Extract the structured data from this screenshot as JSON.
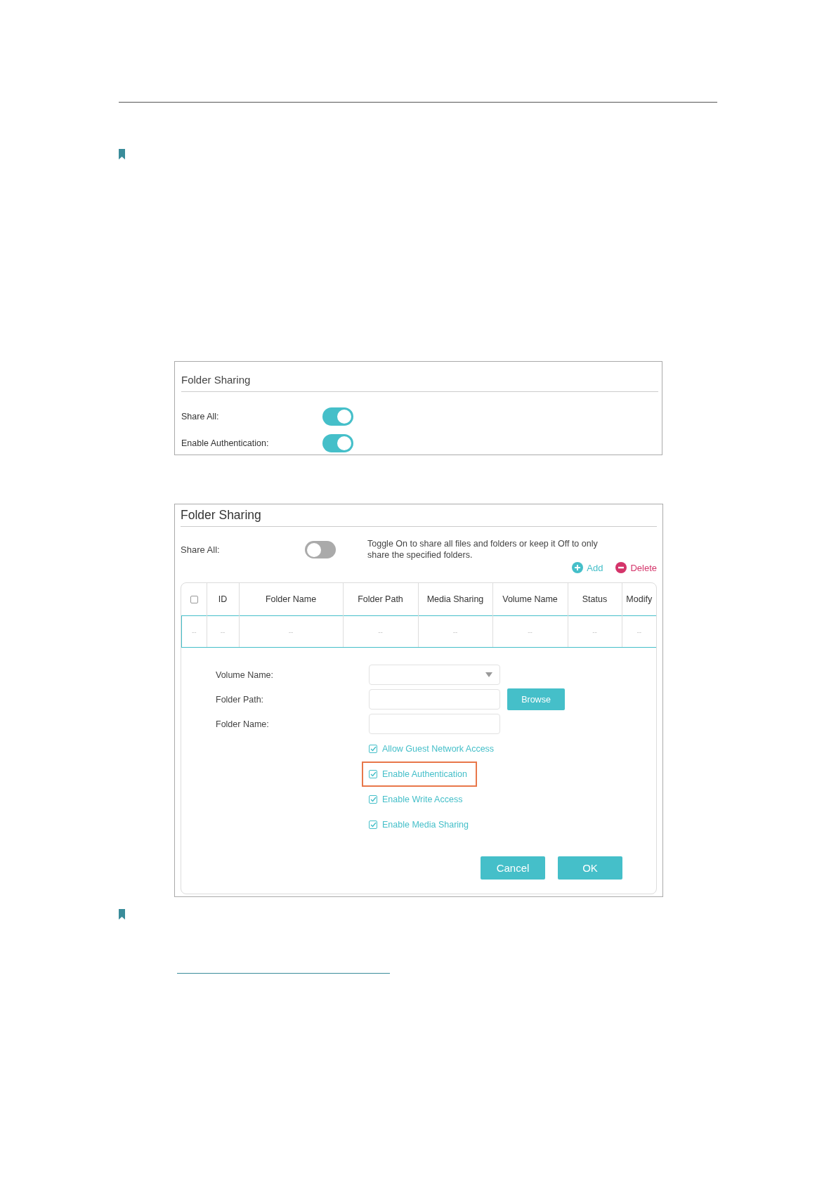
{
  "panels": [
    {
      "title": "Folder Sharing",
      "rows": [
        {
          "label": "Share All:",
          "on": true
        },
        {
          "label": "Enable Authentication:",
          "on": true
        }
      ]
    },
    {
      "title": "Folder Sharing",
      "share_all": {
        "label": "Share All:",
        "on": false
      },
      "hint": "Toggle On to share all files and folders or keep it Off to only share the specified folders.",
      "actions": [
        {
          "label": "Add",
          "kind": "add"
        },
        {
          "label": "Delete",
          "kind": "delete"
        }
      ],
      "table": {
        "select_all": {
          "checked": false
        },
        "columns": [
          "",
          "ID",
          "Folder Name",
          "Folder Path",
          "Media Sharing",
          "Volume Name",
          "Status",
          "Modify"
        ],
        "rows": [
          [
            "--",
            "--",
            "--",
            "--",
            "--",
            "--",
            "--",
            "--"
          ]
        ]
      },
      "form": {
        "fields": [
          {
            "label": "Volume Name:",
            "kind": "select"
          },
          {
            "label": "Folder Path:",
            "kind": "text",
            "button": "Browse"
          },
          {
            "label": "Folder Name:",
            "kind": "text"
          }
        ],
        "options": [
          {
            "label": "Allow Guest Network Access",
            "checked": true,
            "highlighted": false
          },
          {
            "label": "Enable Authentication",
            "checked": true,
            "highlighted": true
          },
          {
            "label": "Enable Write Access",
            "checked": true,
            "highlighted": false
          },
          {
            "label": "Enable Media Sharing",
            "checked": true,
            "highlighted": false
          }
        ],
        "buttons": [
          "Cancel",
          "OK"
        ]
      }
    }
  ]
}
